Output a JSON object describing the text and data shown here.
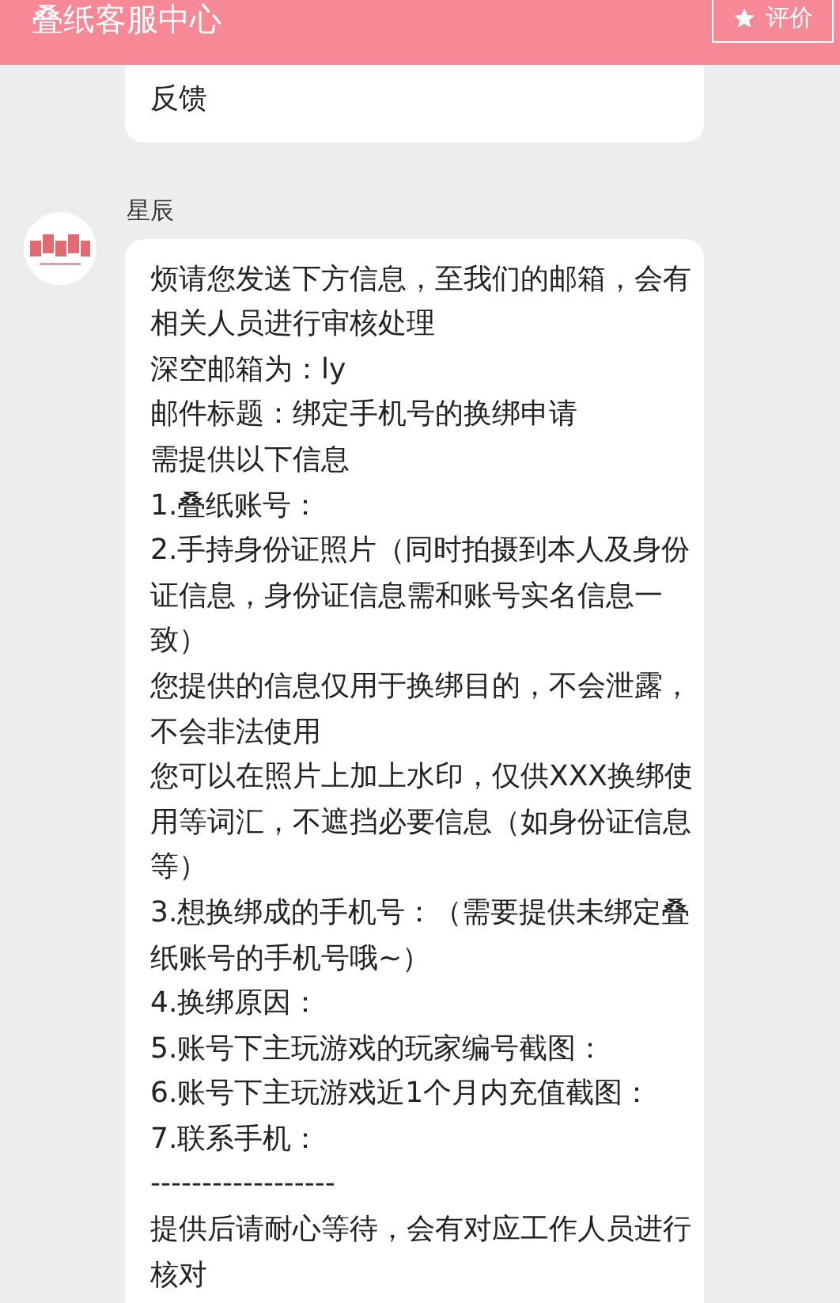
{
  "header": {
    "title": "叠纸客服中心",
    "rate_button": "评价"
  },
  "messages": [
    {
      "lines": [
        "反馈"
      ]
    },
    {
      "sender": "星辰",
      "lines": [
        "烦请您发送下方信息，至我们的邮箱，会有相关人员进行审核处理",
        "深空邮箱为：ly",
        "邮件标题：绑定手机号的换绑申请",
        "需提供以下信息",
        "1.叠纸账号：",
        "2.手持身份证照片（同时拍摄到本人及身份证信息，身份证信息需和账号实名信息一致）",
        "您提供的信息仅用于换绑目的，不会泄露，不会非法使用",
        "您可以在照片上加上水印，仅供XXX换绑使用等词汇，不遮挡必要信息（如身份证信息等）",
        "3.想换绑成的手机号：（需要提供未绑定叠纸账号的手机号哦~）",
        "4.换绑原因：",
        "5.账号下主玩游戏的玩家编号截图：",
        "6.账号下主玩游戏近1个月内充值截图：",
        "7.联系手机：",
        "------------------",
        "提供后请耐心等待，会有对应工作人员进行核对"
      ]
    }
  ]
}
